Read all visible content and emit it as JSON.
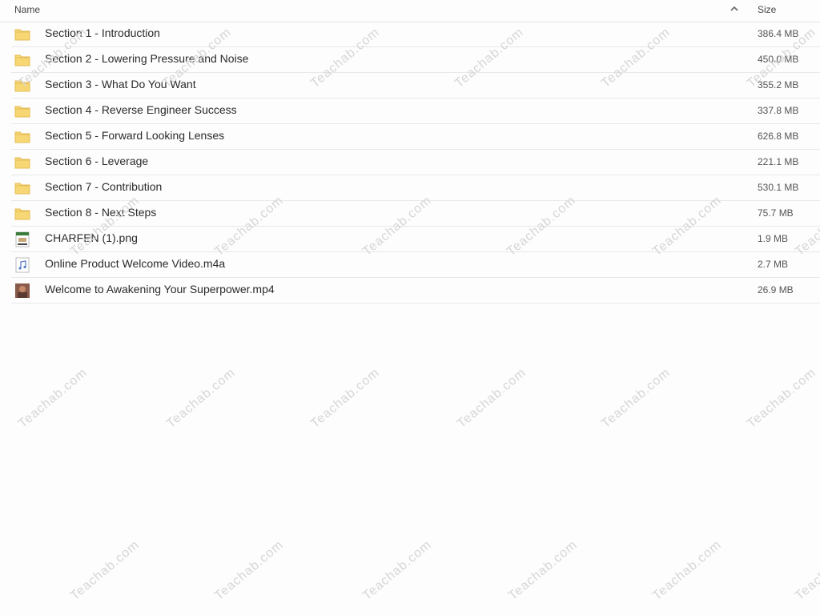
{
  "header": {
    "name_label": "Name",
    "size_label": "Size",
    "sort_icon": "chevron-up-icon"
  },
  "files": [
    {
      "name": "Section 1 - Introduction",
      "size": "386.4 MB",
      "icon": "folder-icon"
    },
    {
      "name": "Section 2 - Lowering Pressure and Noise",
      "size": "450.0 MB",
      "icon": "folder-icon"
    },
    {
      "name": "Section 3 - What Do You Want",
      "size": "355.2 MB",
      "icon": "folder-icon"
    },
    {
      "name": "Section 4 - Reverse Engineer Success",
      "size": "337.8 MB",
      "icon": "folder-icon"
    },
    {
      "name": "Section 5 - Forward Looking Lenses",
      "size": "626.8 MB",
      "icon": "folder-icon"
    },
    {
      "name": "Section 6 - Leverage",
      "size": "221.1 MB",
      "icon": "folder-icon"
    },
    {
      "name": "Section 7 - Contribution",
      "size": "530.1 MB",
      "icon": "folder-icon"
    },
    {
      "name": "Section 8 - Next Steps",
      "size": "75.7 MB",
      "icon": "folder-icon"
    },
    {
      "name": "CHARFEN (1).png",
      "size": "1.9 MB",
      "icon": "image-file-icon"
    },
    {
      "name": "Online Product Welcome Video.m4a",
      "size": "2.7 MB",
      "icon": "audio-file-icon"
    },
    {
      "name": "Welcome to Awakening Your Superpower.mp4",
      "size": "26.9 MB",
      "icon": "video-file-icon"
    }
  ],
  "watermark": "Teachab.com",
  "colors": {
    "folder": "#f7d774",
    "folder_dark": "#e8c25a",
    "divider": "#e8e8e8",
    "watermark": "#d6d6d6"
  }
}
